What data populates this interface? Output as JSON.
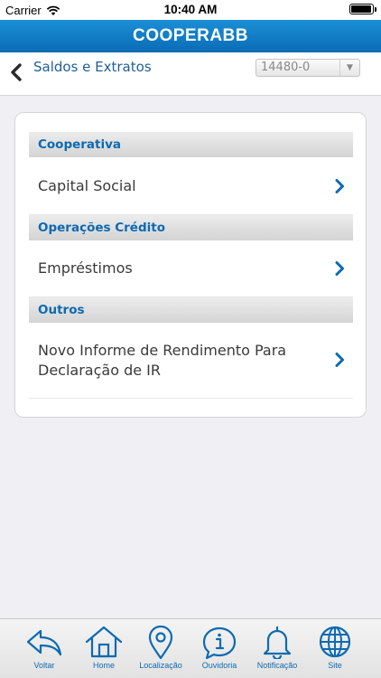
{
  "status_bar": {
    "carrier": "Carrier",
    "time": "10:40 AM"
  },
  "header": {
    "title": "COOPERABB"
  },
  "nav": {
    "back_label": "back",
    "title": "Saldos e Extratos",
    "account_value": "14480-0"
  },
  "sections": [
    {
      "title": "Cooperativa",
      "items": [
        {
          "label": "Capital Social"
        }
      ]
    },
    {
      "title": "Operações Crédito",
      "items": [
        {
          "label": "Empréstimos"
        }
      ]
    },
    {
      "title": "Outros",
      "items": [
        {
          "label_line1": "Novo Informe de Rendimento Para",
          "label_line2": "Declaração de IR"
        }
      ]
    }
  ],
  "tabbar": {
    "items": [
      {
        "label": "Voltar",
        "icon": "back-arrow-icon"
      },
      {
        "label": "Home",
        "icon": "home-icon"
      },
      {
        "label": "Localização",
        "icon": "location-pin-icon"
      },
      {
        "label": "Ouvidoria",
        "icon": "info-icon"
      },
      {
        "label": "Notificação",
        "icon": "bell-icon"
      },
      {
        "label": "Site",
        "icon": "globe-icon"
      }
    ]
  },
  "colors": {
    "brand_blue": "#0a6cb5",
    "link_blue": "#0d6ab2"
  }
}
